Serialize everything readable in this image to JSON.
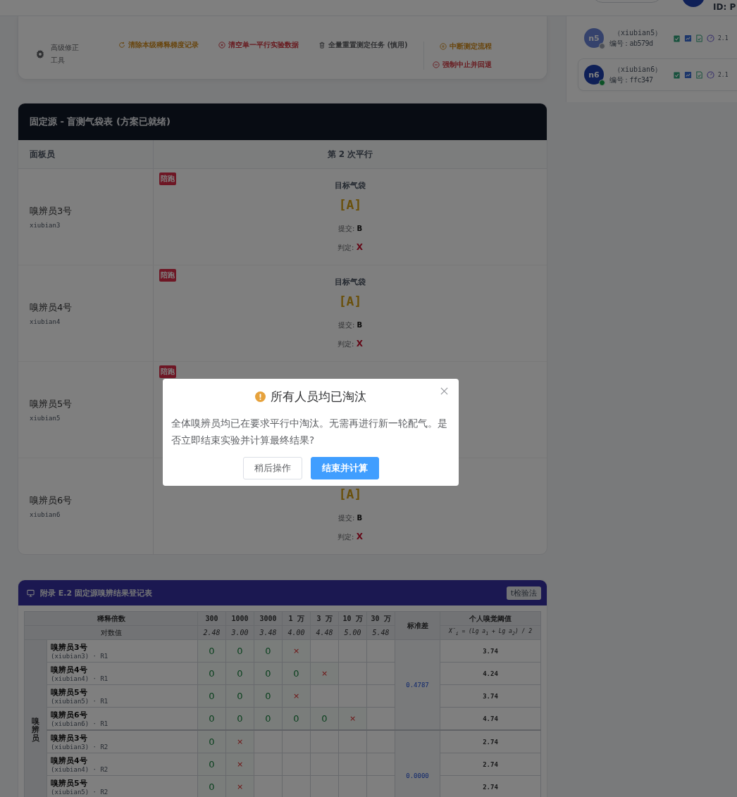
{
  "header": {
    "user_id": "ID: P"
  },
  "members": [
    {
      "avatar": "n5",
      "account": "（xiubian5）",
      "code": "编号：ab579d",
      "score": "2.1",
      "online": false,
      "selected": false
    },
    {
      "avatar": "n6",
      "account": "（xiubian6）",
      "code": "编号：ffc347",
      "score": "2.1",
      "online": true,
      "selected": true
    }
  ],
  "tools": {
    "title": "高级修正工具",
    "actions": [
      {
        "label": "清除本级稀释梯度记录",
        "kind": "warning"
      },
      {
        "label": "清空单一平行实验数据",
        "kind": "danger"
      },
      {
        "label": "全量重置测定任务 (慎用)",
        "kind": "neutral"
      }
    ],
    "flow_actions": [
      {
        "label": "中断测定流程",
        "kind": "warning"
      },
      {
        "label": "强制中止并回退",
        "kind": "danger"
      }
    ]
  },
  "blind_table": {
    "title": "固定源 - 盲测气袋表 (方案已就绪)",
    "columns": [
      "面板员",
      "第 2 次平行"
    ],
    "rows": [
      {
        "name": "嗅辨员3号",
        "account": "xiubian3",
        "badge": "陪跑",
        "target_label": "目标气袋",
        "target": "[A]",
        "submit_label": "提交:",
        "submit": "B",
        "verdict_label": "判定:",
        "verdict": "X"
      },
      {
        "name": "嗅辨员4号",
        "account": "xiubian4",
        "badge": "陪跑",
        "target_label": "目标气袋",
        "target": "[A]",
        "submit_label": "提交:",
        "submit": "B",
        "verdict_label": "判定:",
        "verdict": "X"
      },
      {
        "name": "嗅辨员5号",
        "account": "xiubian5",
        "badge": "陪跑"
      },
      {
        "name": "嗅辨员6号",
        "account": "xiubian6",
        "target": "[A]",
        "submit_label": "提交:",
        "submit": "B",
        "verdict_label": "判定:",
        "verdict": "X"
      }
    ]
  },
  "results": {
    "title": "附录 E.2 固定源嗅辨结果登记表",
    "button": "t检验法",
    "dilution_label": "稀释倍数",
    "dilutions": [
      "300",
      "1000",
      "3000",
      "1 万",
      "3 万",
      "10 万",
      "30 万"
    ],
    "log_label": "对数值",
    "logs": [
      "2.48",
      "3.00",
      "3.48",
      "4.00",
      "4.48",
      "5.00",
      "5.48"
    ],
    "std_label": "标准差",
    "threshold_label": "个人嗅觉阈值",
    "formula": "X̄$_{i}$ = (Lg a$_{1}$ + Lg a$_{2}$) / 2",
    "group_label": "嗅辨员",
    "groups": [
      {
        "std": "0.4787",
        "rows": [
          {
            "name": "嗅辨员3号",
            "account": "(xiubian3) · R1",
            "threshold": "3.74",
            "cells": [
              {
                "mark": "0",
                "kind": "pass"
              },
              {
                "mark": "0",
                "kind": "pass"
              },
              {
                "mark": "0",
                "kind": "pass"
              },
              {
                "mark": "×",
                "kind": "fail"
              },
              null,
              null,
              null
            ]
          },
          {
            "name": "嗅辨员4号",
            "account": "(xiubian4) · R1",
            "threshold": "4.24",
            "cells": [
              {
                "mark": "0",
                "kind": "pass"
              },
              {
                "mark": "0",
                "kind": "pass"
              },
              {
                "mark": "0",
                "kind": "pass"
              },
              {
                "mark": "0",
                "kind": "pass"
              },
              {
                "mark": "×",
                "kind": "fail"
              },
              null,
              null
            ]
          },
          {
            "name": "嗅辨员5号",
            "account": "(xiubian5) · R1",
            "threshold": "3.74",
            "cells": [
              {
                "mark": "0",
                "kind": "pass"
              },
              {
                "mark": "0",
                "kind": "pass"
              },
              {
                "mark": "0",
                "kind": "pass"
              },
              {
                "mark": "×",
                "kind": "fail"
              },
              null,
              null,
              null
            ]
          },
          {
            "name": "嗅辨员6号",
            "account": "(xiubian6) · R1",
            "threshold": "4.74",
            "cells": [
              {
                "mark": "0",
                "kind": "pass"
              },
              {
                "mark": "0",
                "kind": "pass"
              },
              {
                "mark": "0",
                "kind": "pass"
              },
              {
                "mark": "0",
                "kind": "pass"
              },
              {
                "mark": "0",
                "kind": "pass"
              },
              {
                "mark": "×",
                "kind": "fail"
              },
              null
            ]
          }
        ]
      },
      {
        "std": "0.0000",
        "rows": [
          {
            "name": "嗅辨员3号",
            "account": "(xiubian3) · R2",
            "threshold": "2.74",
            "cells": [
              {
                "mark": "0",
                "kind": "pass"
              },
              {
                "mark": "×",
                "kind": "fail"
              },
              null,
              null,
              null,
              null,
              null
            ]
          },
          {
            "name": "嗅辨员4号",
            "account": "(xiubian4) · R2",
            "threshold": "2.74",
            "cells": [
              {
                "mark": "0",
                "kind": "pass"
              },
              {
                "mark": "×",
                "kind": "fail"
              },
              null,
              null,
              null,
              null,
              null
            ]
          },
          {
            "name": "嗅辨员5号",
            "account": "(xiubian5) · R2",
            "threshold": "2.74",
            "cells": [
              {
                "mark": "0",
                "kind": "pass"
              },
              {
                "mark": "×",
                "kind": "fail"
              },
              null,
              null,
              null,
              null,
              null
            ]
          }
        ]
      }
    ]
  },
  "dialog": {
    "title": "所有人员均已淘汰",
    "message": "全体嗅辨员均已在要求平行中淘汰。无需再进行新一轮配气。是否立即结束实验并计算最终结果?",
    "buttons": [
      {
        "label": "稍后操作",
        "kind": "secondary"
      },
      {
        "label": "结束并计算",
        "kind": "primary"
      }
    ]
  }
}
